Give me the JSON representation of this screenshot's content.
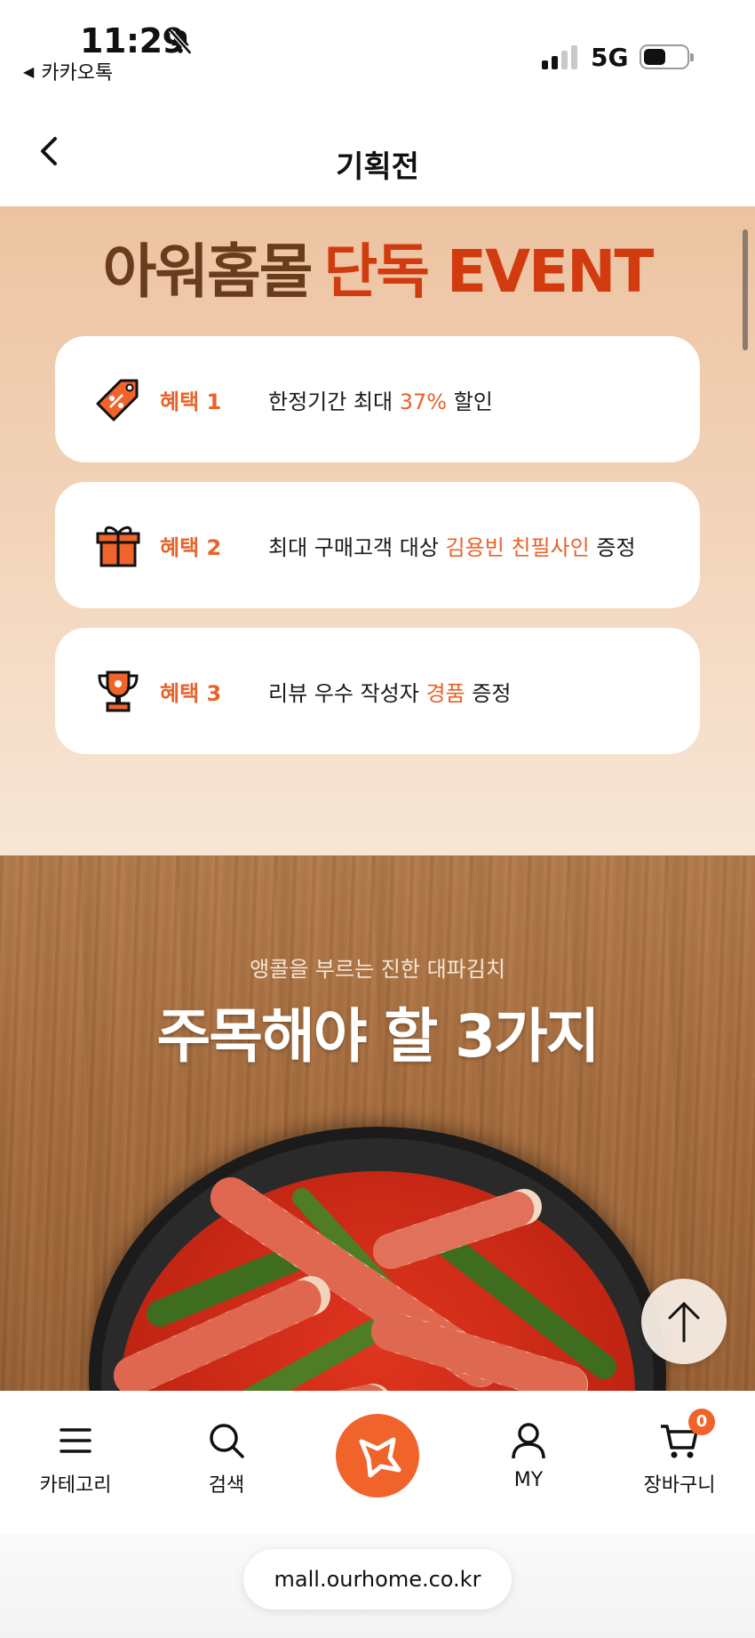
{
  "status_bar": {
    "time": "11:29",
    "back_app": "카카오톡",
    "network": "5G",
    "icons": [
      "bell-slash-icon",
      "signal-icon",
      "battery-icon"
    ]
  },
  "header": {
    "title": "기획전",
    "back_icon": "chevron-left-icon"
  },
  "event": {
    "title_brand": "아워홈몰",
    "title_highlight": "단독 EVENT",
    "benefits": [
      {
        "tag": "혜택 1",
        "icon": "discount-tag-icon",
        "text_before": "한정기간 최대 ",
        "highlight": "37%",
        "text_after": " 할인"
      },
      {
        "tag": "혜택 2",
        "icon": "gift-icon",
        "text_before": "최대 구매고객 대상 ",
        "highlight": "김용빈 친필사인",
        "text_after": " 증정"
      },
      {
        "tag": "혜택 3",
        "icon": "trophy-icon",
        "text_before": "리뷰 우수 작성자 ",
        "highlight": "경품",
        "text_after": " 증정"
      }
    ]
  },
  "hero": {
    "subtitle": "앵콜을 부르는 진한 대파김치",
    "headline": "주목해야 할 3가지",
    "image": "green-onion-kimchi-bowl"
  },
  "scroll_top_icon": "arrow-up-icon",
  "bottom_nav": {
    "items": [
      {
        "label": "카테고리",
        "icon": "menu-icon"
      },
      {
        "label": "검색",
        "icon": "search-icon"
      },
      {
        "label": "",
        "icon": "ourhome-logo-icon"
      },
      {
        "label": "MY",
        "icon": "user-icon"
      },
      {
        "label": "장바구니",
        "icon": "cart-icon",
        "badge": "0"
      }
    ]
  },
  "url": "mall.ourhome.co.kr",
  "colors": {
    "accent": "#f0632b",
    "event_title": "#d23a10",
    "brand_brown": "#6a3c1e"
  }
}
